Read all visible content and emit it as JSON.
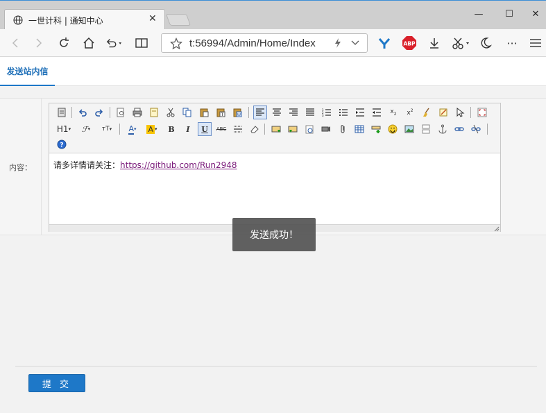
{
  "browser": {
    "tab_title": "一世计科 | 通知中心",
    "tab_close": "✕",
    "url": "t:56994/Admin/Home/Index",
    "window_controls": {
      "minimize": "—",
      "maximize": "☐",
      "close": "✕"
    },
    "toolbar_icons": [
      "back-icon",
      "forward-icon",
      "refresh-icon",
      "home-icon",
      "undo-icon",
      "reading-view-icon",
      "star-icon",
      "bolt-icon",
      "dropdown-icon",
      "yandex-icon",
      "adblock-icon",
      "download-icon",
      "scissors-icon",
      "moon-icon",
      "more-icon",
      "menu-icon"
    ],
    "adblock_label": "ABP",
    "more_label": "···"
  },
  "page": {
    "tab_label": "发送站内信",
    "content_label": "内容：",
    "editor": {
      "text_prefix": "请多详情请关注：",
      "link_text": "https://github.com/Run2948"
    },
    "toast": "发送成功！",
    "submit_label": "提 交"
  },
  "colors": {
    "accent": "#1e78c8",
    "link": "#7a1a7a",
    "toast_bg": "#505050"
  }
}
